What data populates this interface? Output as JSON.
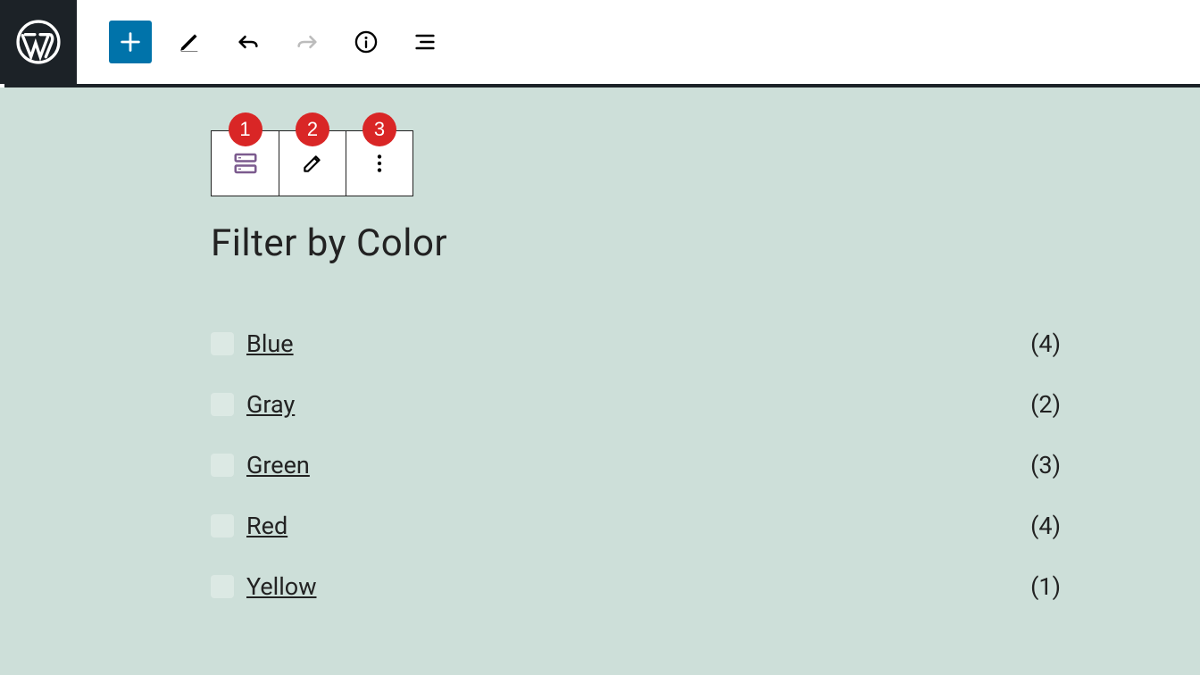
{
  "toolbar_badges": [
    "1",
    "2",
    "3"
  ],
  "heading": "Filter by Color",
  "filters": [
    {
      "label": "Blue",
      "count": "(4)"
    },
    {
      "label": "Gray",
      "count": "(2)"
    },
    {
      "label": "Green",
      "count": "(3)"
    },
    {
      "label": "Red",
      "count": "(4)"
    },
    {
      "label": "Yellow",
      "count": "(1)"
    }
  ]
}
